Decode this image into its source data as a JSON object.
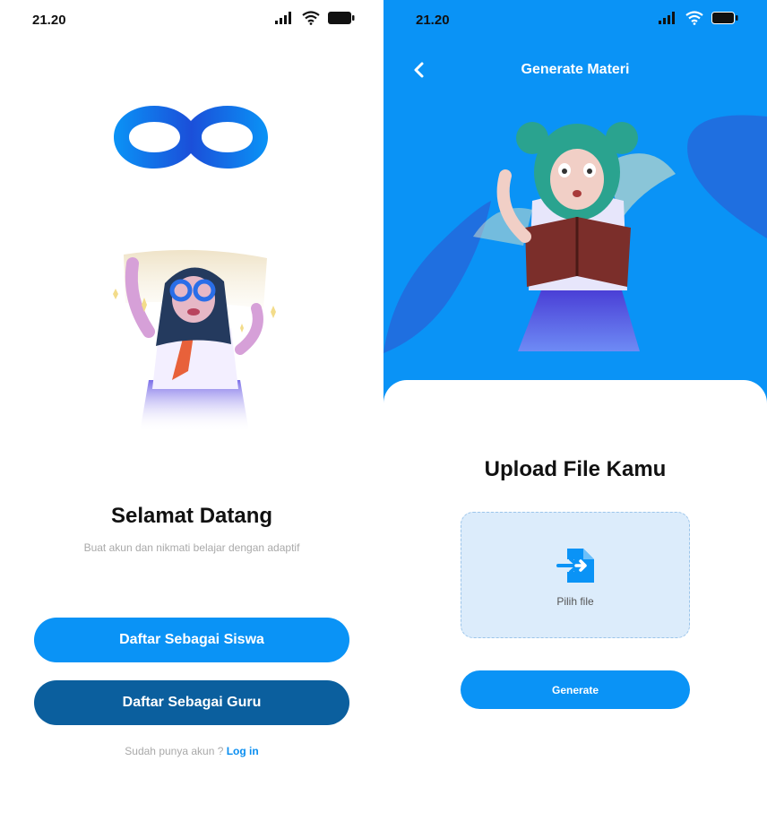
{
  "welcome_screen": {
    "status_time": "21.20",
    "title": "Selamat Datang",
    "subtitle": "Buat akun dan nikmati belajar dengan adaptif",
    "button_student": "Daftar Sebagai Siswa",
    "button_teacher": "Daftar Sebagai Guru",
    "login_prompt": "Sudah punya akun ?",
    "login_link": "Log in",
    "logo": "infinity-logo",
    "illustration": "girl-with-glasses-illustration"
  },
  "generate_screen": {
    "status_time": "21.20",
    "header_title": "Generate Materi",
    "back_icon": "chevron-left-icon",
    "illustration": "girl-reading-book-illustration",
    "upload_title": "Upload File Kamu",
    "upload_icon": "file-import-icon",
    "upload_label": "Pilih file",
    "button_generate": "Generate"
  },
  "colors": {
    "primary": "#0a93f6",
    "primary_dark": "#0b5f9e",
    "upload_box": "#dcecfb",
    "link": "#0a8ef0"
  }
}
